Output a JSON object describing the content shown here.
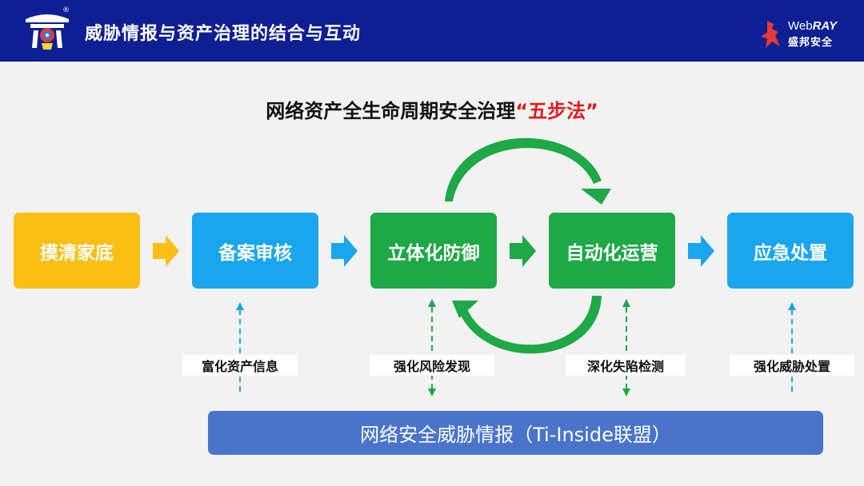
{
  "header": {
    "title": "威胁情报与资产治理的结合与互动",
    "registered_mark": "®",
    "brand_en_prefix": "Web",
    "brand_en_suffix": "RAY",
    "brand_cn": "盛邦安全",
    "bg_color": "#0e1f94"
  },
  "subtitle": {
    "main": "网络资产全生命周期安全治理",
    "highlight": "“五步法”",
    "highlight_color": "#e11a1a"
  },
  "steps": [
    {
      "label": "摸清家底",
      "color": "#fbbf14"
    },
    {
      "label": "备案审核",
      "color": "#1aa6ee"
    },
    {
      "label": "立体化防御",
      "color": "#1ea846"
    },
    {
      "label": "自动化运营",
      "color": "#1ea846"
    },
    {
      "label": "应急处置",
      "color": "#1aa6ee"
    }
  ],
  "intel_labels": [
    "富化资产信息",
    "强化风险发现",
    "深化失陷检测",
    "强化威胁处置"
  ],
  "bottom_bar": {
    "label": "网络安全威胁情报（Ti-Inside联盟）",
    "color": "#4a74cc"
  },
  "arrow_colors": {
    "yellow": "#fbbf14",
    "blue": "#1aa6ee",
    "green": "#1ea846"
  }
}
